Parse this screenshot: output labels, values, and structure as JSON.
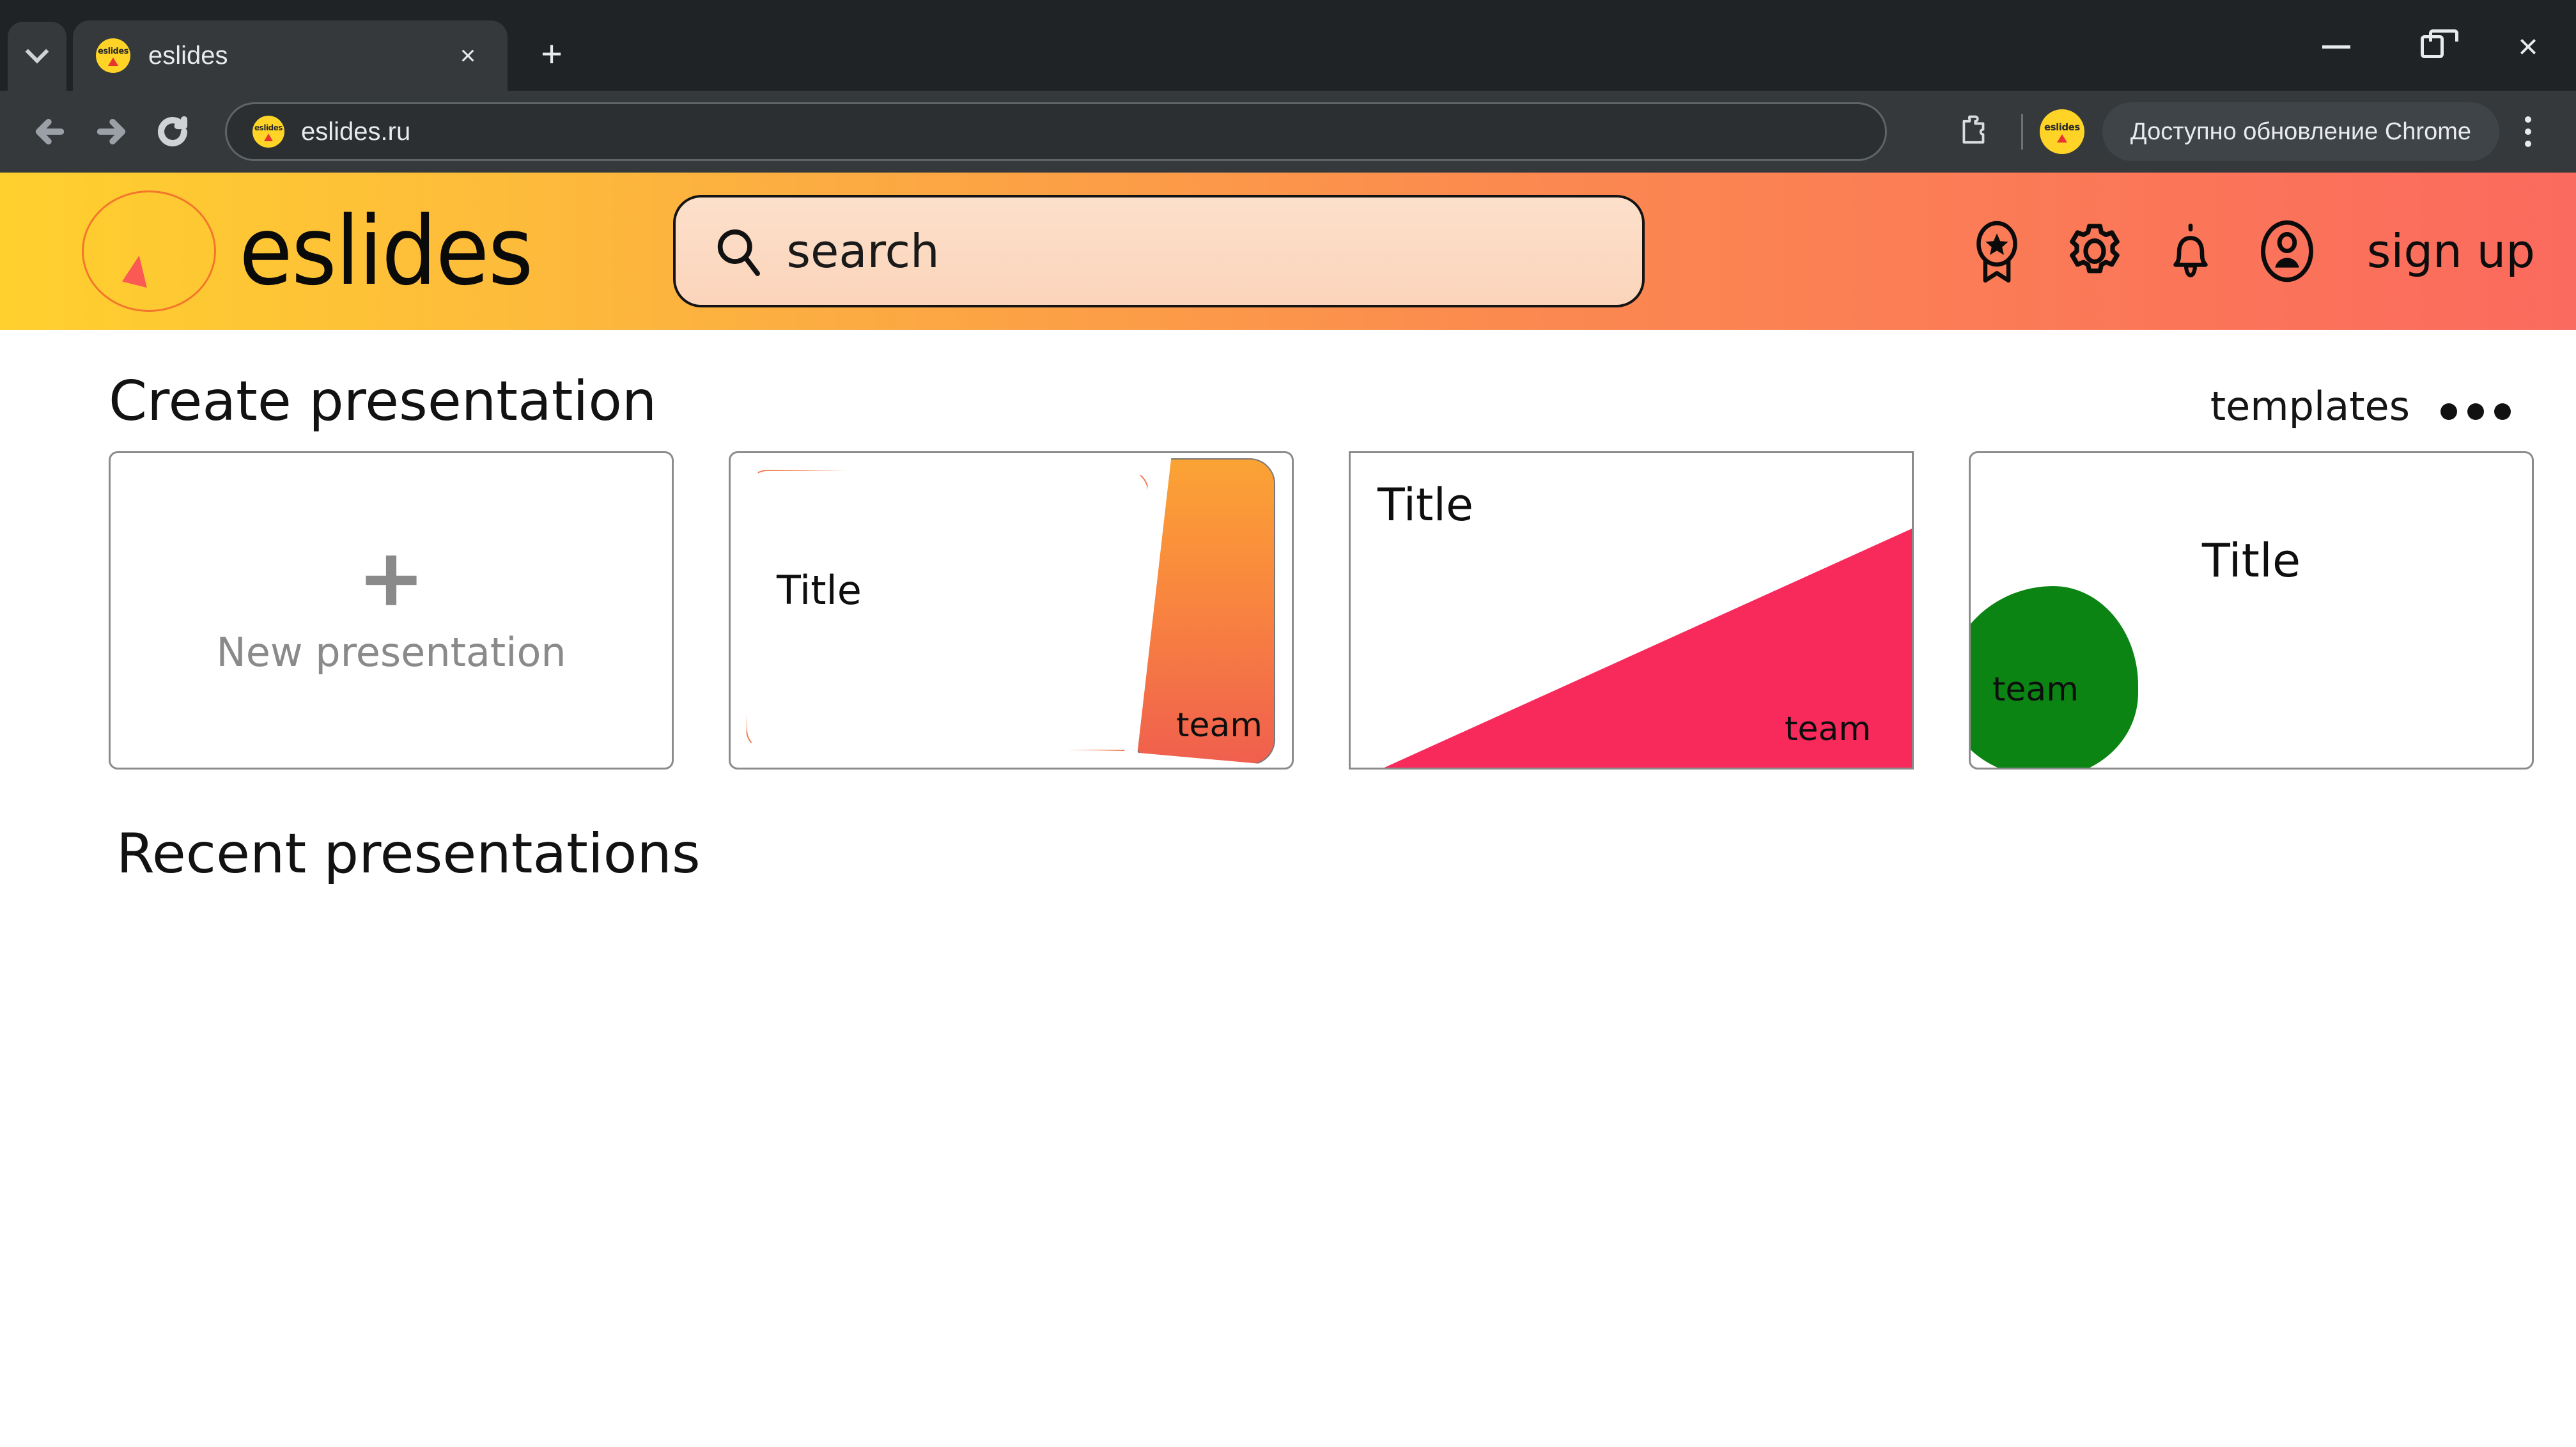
{
  "browser": {
    "tab_search_icon": "chevron-down-icon",
    "tab": {
      "title": "eslides",
      "favicon_text": "eslides",
      "close_glyph": "×"
    },
    "new_tab_glyph": "+",
    "window_controls": {
      "minimize": "minimize-icon",
      "maximize": "maximize-icon",
      "close": "×"
    },
    "toolbar": {
      "back_icon": "back-arrow-icon",
      "forward_icon": "forward-arrow-icon",
      "reload_icon": "reload-icon",
      "url": "eslides.ru",
      "extensions_icon": "extensions-icon",
      "profile_icon": "profile-avatar-icon",
      "update_message": "Доступно обновление Chrome",
      "menu_icon": "kebab-menu-icon"
    }
  },
  "site": {
    "header": {
      "brand_name": "eslides",
      "logo_icon": "eslides-circle-triangle-logo",
      "gradient_from": "#FFD02E",
      "gradient_to": "#FB6A5E",
      "search": {
        "placeholder": "search",
        "icon": "search-icon"
      },
      "actions": [
        {
          "icon": "award-ribbon-icon",
          "label": ""
        },
        {
          "icon": "gear-icon",
          "label": ""
        },
        {
          "icon": "bell-icon",
          "label": ""
        },
        {
          "icon": "user-circle-icon",
          "label": "sign up"
        }
      ],
      "signup_label": "sign up"
    },
    "main": {
      "create_section_title": "Create presentation",
      "templates_link": "templates",
      "more_menu_icon": "ellipsis-icon",
      "new_presentation": {
        "plus_icon": "plus-icon",
        "label": "New presentation"
      },
      "templates": [
        {
          "style": "orange-gradient-panel",
          "title": "Title",
          "team": "team",
          "accent_from": "#FBA334",
          "accent_to": "#F05F4E",
          "outline": "#F07B4E"
        },
        {
          "style": "crimson-diagonal",
          "title": "Title",
          "team": "team",
          "accent": "#F72A5B"
        },
        {
          "style": "green-blob",
          "title": "Title",
          "team": "team",
          "accent": "#0B8413"
        }
      ],
      "recent_section_title": "Recent presentations"
    }
  }
}
